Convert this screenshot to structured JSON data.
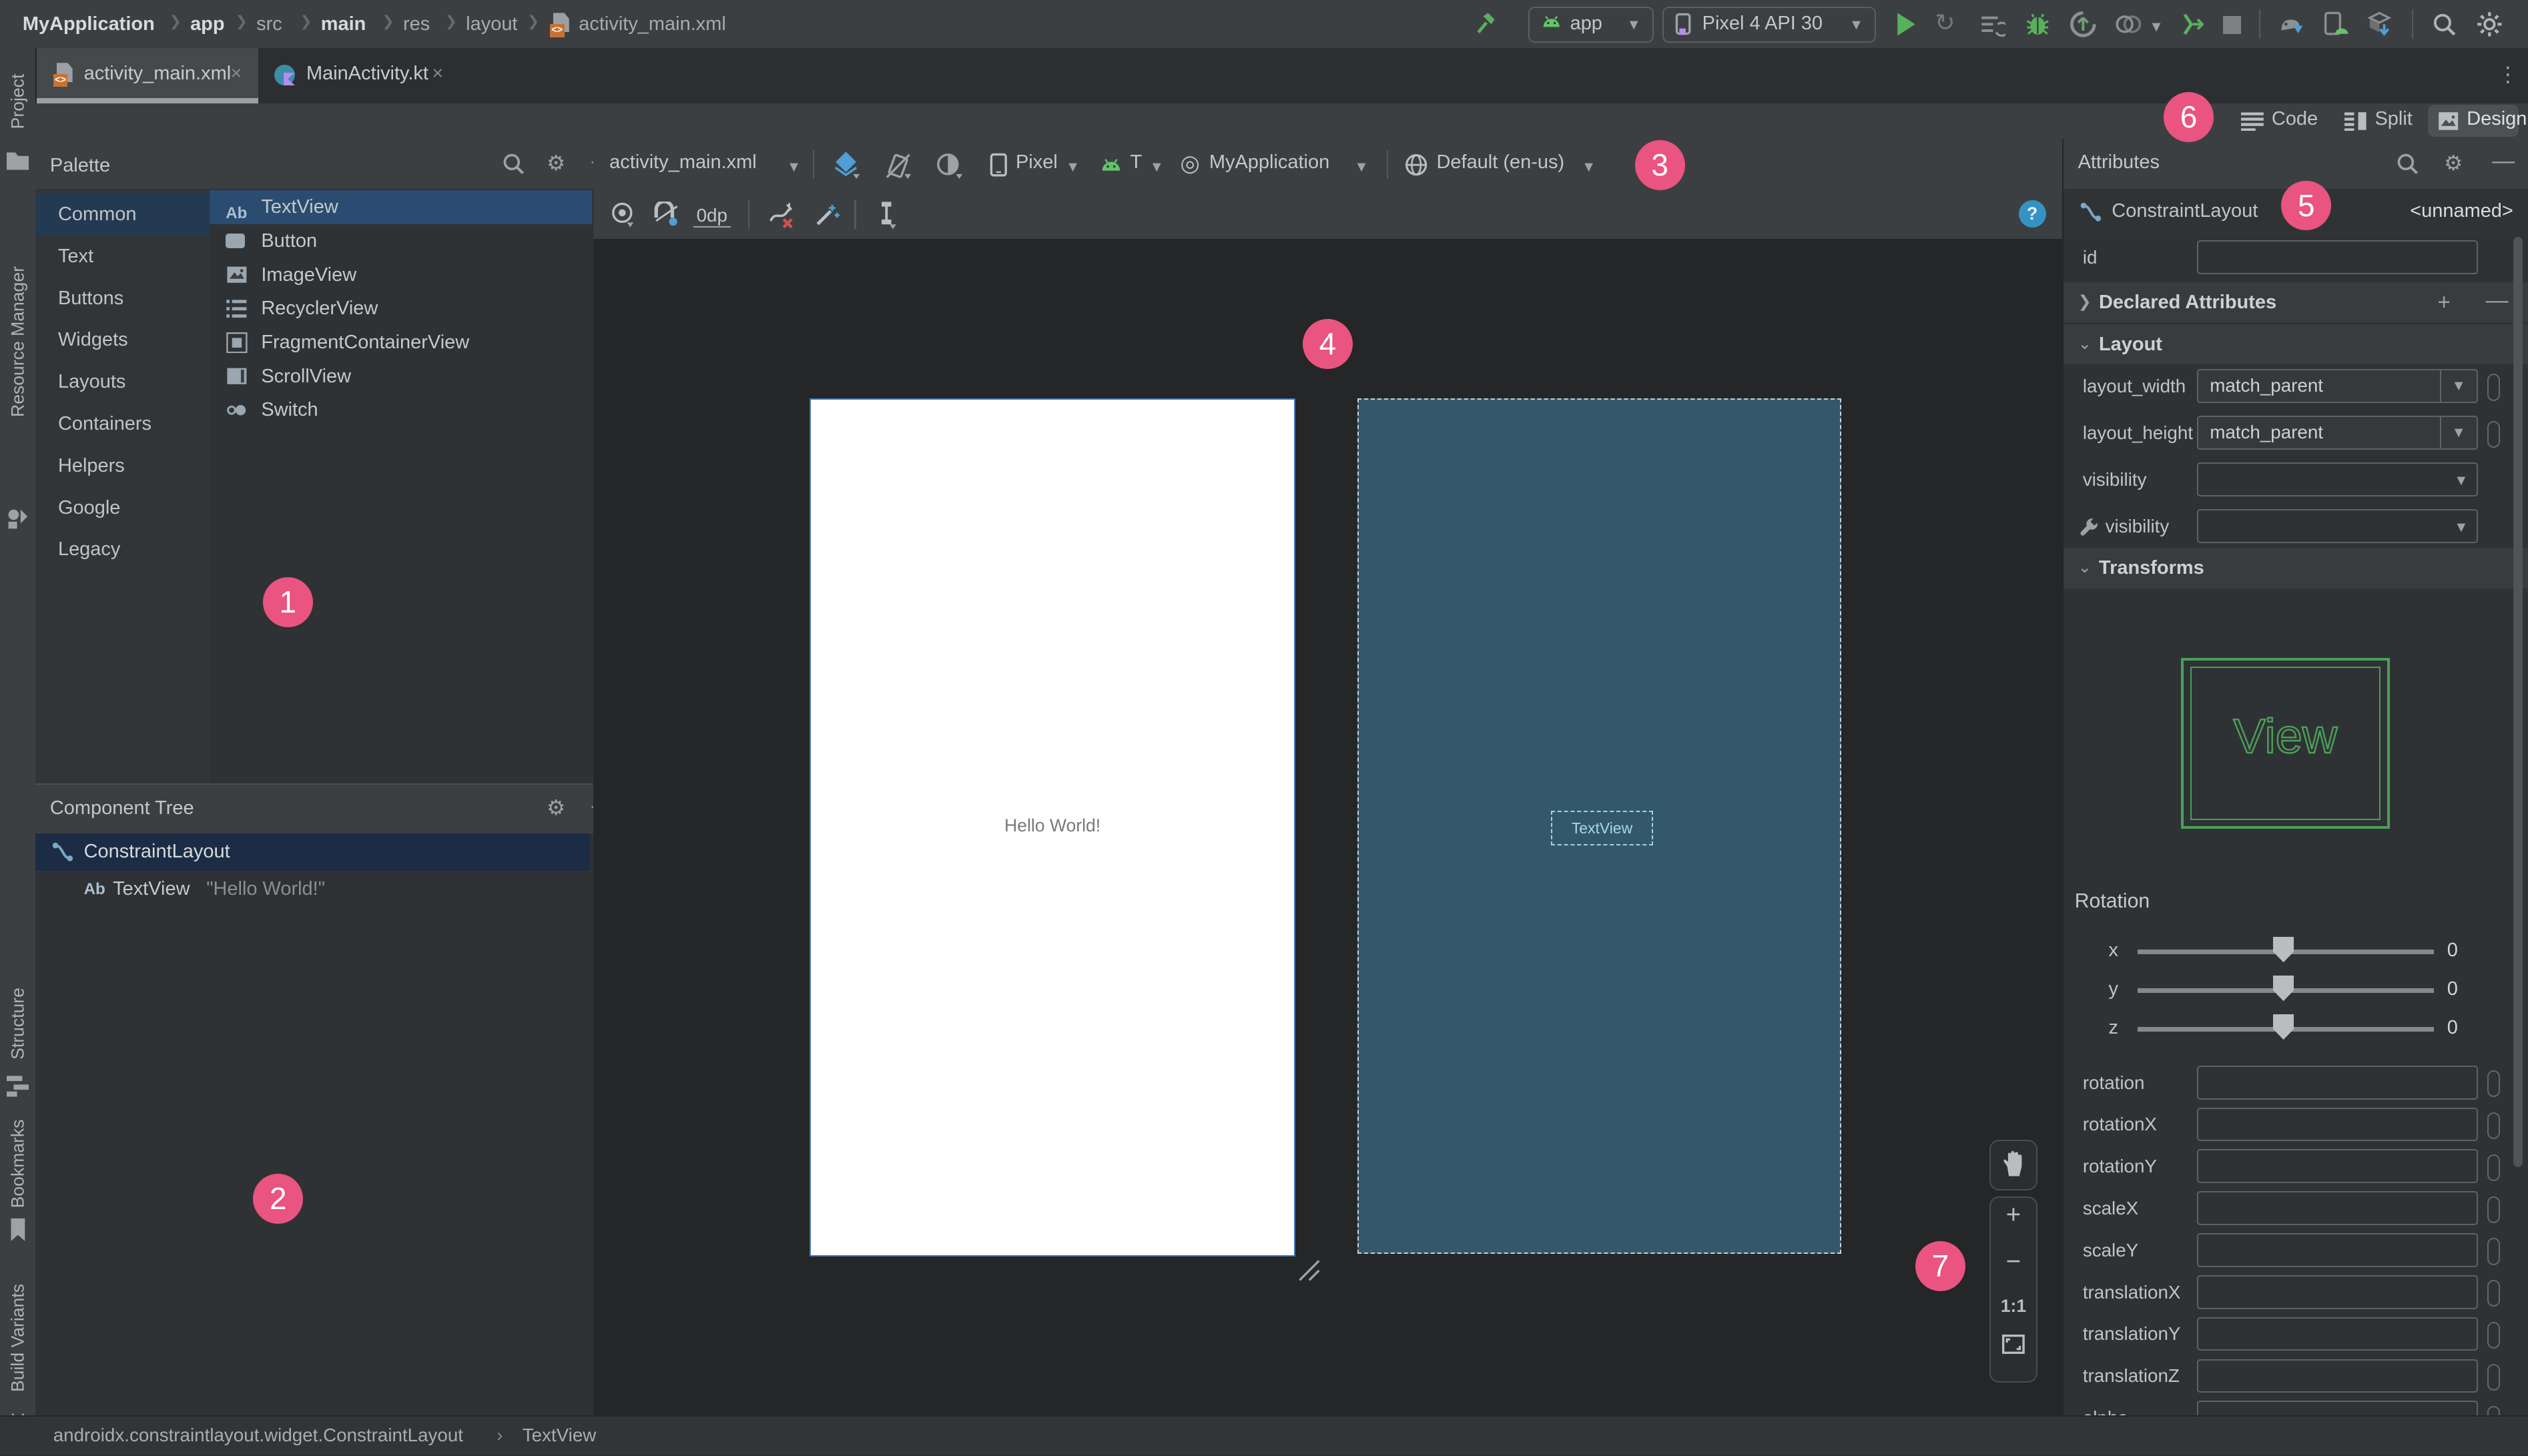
{
  "colors": {
    "accent_pink": "#ea5480",
    "selection_blue": "#2a4c70",
    "tree_selection": "#1b2c44",
    "blueprint": "#33586c",
    "panel": "#3c3f41",
    "canvas": "#242628",
    "green": "#57b15c"
  },
  "breadcrumb": {
    "items": [
      {
        "label": "MyApplication",
        "bold": true
      },
      {
        "label": "app",
        "bold": true
      },
      {
        "label": "src",
        "bold": false
      },
      {
        "label": "main",
        "bold": true
      },
      {
        "label": "res",
        "bold": false
      },
      {
        "label": "layout",
        "bold": false
      }
    ],
    "file": "activity_main.xml"
  },
  "tabs": {
    "tab1": "activity_main.xml",
    "tab2": "MainActivity.kt",
    "close": "×"
  },
  "run_toolbar": {
    "config": "app",
    "device": "Pixel 4 API 30"
  },
  "left_rail": {
    "project": "Project",
    "resource_manager": "Resource Manager",
    "structure": "Structure",
    "bookmarks": "Bookmarks",
    "build_variants": "Build Variants"
  },
  "palette": {
    "title": "Palette",
    "categories": [
      "Common",
      "Text",
      "Buttons",
      "Widgets",
      "Layouts",
      "Containers",
      "Helpers",
      "Google",
      "Legacy"
    ],
    "items": [
      {
        "label": "TextView",
        "icon_text": "Ab"
      },
      {
        "label": "Button"
      },
      {
        "label": "ImageView"
      },
      {
        "label": "RecyclerView"
      },
      {
        "label": "FragmentContainerView"
      },
      {
        "label": "ScrollView"
      },
      {
        "label": "Switch"
      }
    ]
  },
  "component_tree": {
    "title": "Component Tree",
    "root": "ConstraintLayout",
    "child": "TextView",
    "child_icon": "Ab",
    "child_value": "\"Hello World!\""
  },
  "design_toolbar": {
    "file": "activity_main.xml",
    "device": "Pixel",
    "api": "T",
    "theme": "MyApplication",
    "locale": "Default (en-us)",
    "margin": "0dp"
  },
  "modes": {
    "code": "Code",
    "split": "Split",
    "design": "Design"
  },
  "canvas": {
    "hello": "Hello World!",
    "blueprint_label": "TextView"
  },
  "zoom_controls": {
    "one_to_one": "1:1",
    "plus": "+",
    "minus": "−"
  },
  "attributes": {
    "title": "Attributes",
    "component": "ConstraintLayout",
    "unnamed": "<unnamed>",
    "id_label": "id",
    "declared": "Declared Attributes",
    "layout": "Layout",
    "transforms": "Transforms",
    "rows": [
      {
        "label": "layout_width",
        "value": "match_parent"
      },
      {
        "label": "layout_height",
        "value": "match_parent"
      },
      {
        "label": "visibility",
        "value": ""
      },
      {
        "label": "visibility",
        "value": "",
        "wrench": true
      }
    ],
    "preview_text": "View",
    "rotation_label": "Rotation",
    "sliders": [
      {
        "label": "x",
        "value": "0"
      },
      {
        "label": "y",
        "value": "0"
      },
      {
        "label": "z",
        "value": "0"
      }
    ],
    "fields": [
      "rotation",
      "rotationX",
      "rotationY",
      "scaleX",
      "scaleY",
      "translationX",
      "translationY",
      "translationZ",
      "alpha"
    ]
  },
  "status_bar": {
    "left": "androidx.constraintlayout.widget.ConstraintLayout",
    "sep": "›",
    "right": "TextView"
  },
  "badges": [
    "1",
    "2",
    "3",
    "4",
    "5",
    "6",
    "7"
  ]
}
